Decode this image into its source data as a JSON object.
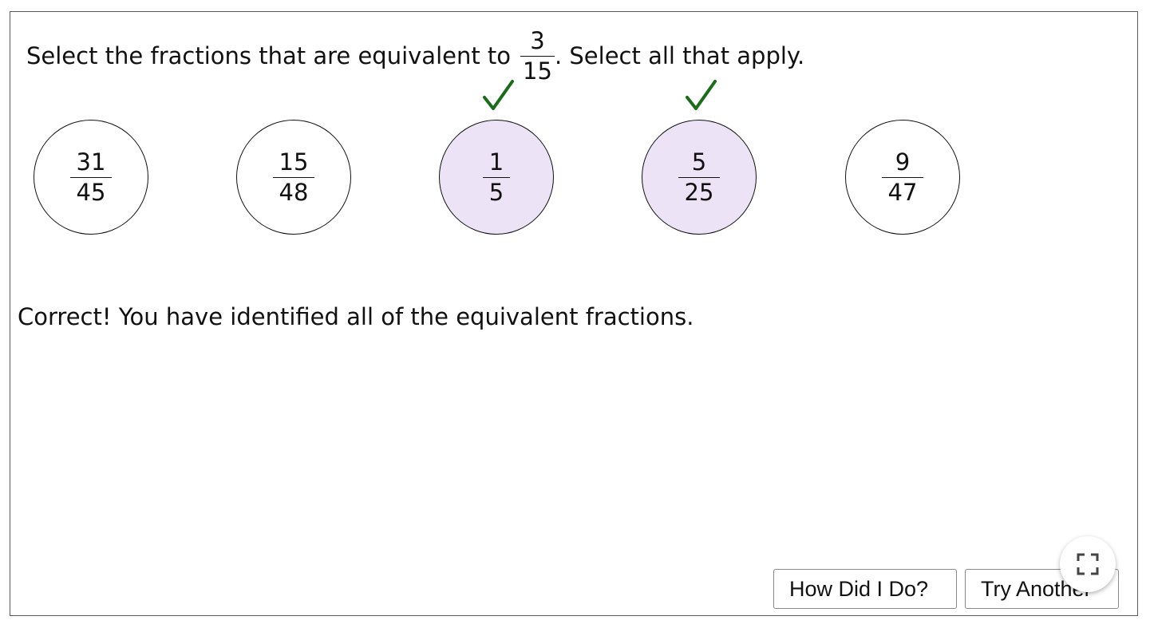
{
  "question": {
    "text_before": "Select the fractions that are equivalent to",
    "target": {
      "numerator": "3",
      "denominator": "15"
    },
    "text_after": ". Select all that apply."
  },
  "choices": [
    {
      "numerator": "31",
      "denominator": "45",
      "selected": false,
      "correct": false
    },
    {
      "numerator": "15",
      "denominator": "48",
      "selected": false,
      "correct": false
    },
    {
      "numerator": "1",
      "denominator": "5",
      "selected": true,
      "correct": true
    },
    {
      "numerator": "5",
      "denominator": "25",
      "selected": true,
      "correct": true
    },
    {
      "numerator": "9",
      "denominator": "47",
      "selected": false,
      "correct": false
    }
  ],
  "feedback": "Correct! You have identified all of the equivalent fractions.",
  "buttons": {
    "check_label": "How Did I Do?",
    "try_another_label": "Try Another"
  },
  "icons": {
    "check": "check-mark-icon",
    "fullscreen": "fullscreen-icon"
  },
  "colors": {
    "selected_fill": "#ede3f6",
    "check_mark": "#1e6b1e",
    "border": "#111111"
  }
}
